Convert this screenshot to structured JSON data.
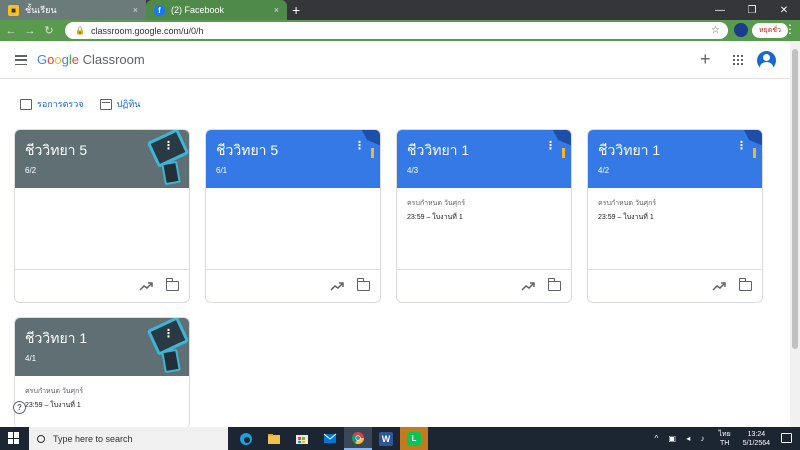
{
  "browser": {
    "tabs": [
      {
        "favicon": "ชั้นเรียน",
        "label": "ชั้นเรียน",
        "close": "×"
      },
      {
        "favicon": "f",
        "label": "(2) Facebook",
        "close": "×"
      }
    ],
    "new_tab": "+",
    "window_controls": [
      "—",
      "❐",
      "✕"
    ],
    "nav": {
      "back": "←",
      "forward": "→",
      "reload": "↻"
    },
    "url": "classroom.google.com/u/0/h",
    "paused_label": "หยุดชั่ว",
    "menu": "⋮"
  },
  "app": {
    "logo": {
      "g1": "G",
      "g2": "o",
      "g3": "o",
      "g1b": "g",
      "g4": "l",
      "g2b": "e",
      "rest": " Classroom"
    },
    "plus": "+",
    "colors": {
      "gray_banner": "#5f6f73",
      "blue_banner": "#3479e6",
      "link": "#1967d2"
    }
  },
  "actions": [
    {
      "label": "รอการตรวจ",
      "icon": "review-icon"
    },
    {
      "label": "ปฏิทิน",
      "icon": "calendar-icon"
    }
  ],
  "cards": [
    {
      "title": "ชีววิทยา 5",
      "section": "6/2",
      "theme": "gray",
      "due": "",
      "task": ""
    },
    {
      "title": "ชีววิทยา 5",
      "section": "6/1",
      "theme": "blue",
      "due": "",
      "task": ""
    },
    {
      "title": "ชีววิทยา 1",
      "section": "4/3",
      "theme": "blue",
      "due": "ครบกำหนด วันศุกร์",
      "task": "23:59 – ใบงานที่ 1"
    },
    {
      "title": "ชีววิทยา 1",
      "section": "4/2",
      "theme": "blue",
      "due": "ครบกำหนด วันศุกร์",
      "task": "23:59 – ใบงานที่ 1"
    },
    {
      "title": "ชีววิทยา 1",
      "section": "4/1",
      "theme": "gray",
      "due": "ครบกำหนด วันศุกร์",
      "task": "23:59 – ใบงานที่ 1"
    }
  ],
  "card_more": "⋮",
  "help": "?",
  "taskbar": {
    "search_placeholder": "Type here to search",
    "apps": [
      "edge-icon",
      "file-explorer-icon",
      "store-icon",
      "mail-icon",
      "chrome-icon",
      "word-icon",
      "line-icon"
    ],
    "word_letter": "W",
    "line_letter": "L",
    "tray_icons": "^ ▣ ◂ ♪",
    "lang_top": "ไทย",
    "lang_bottom": "TH",
    "time": "13:24",
    "date": "5/1/2564"
  }
}
